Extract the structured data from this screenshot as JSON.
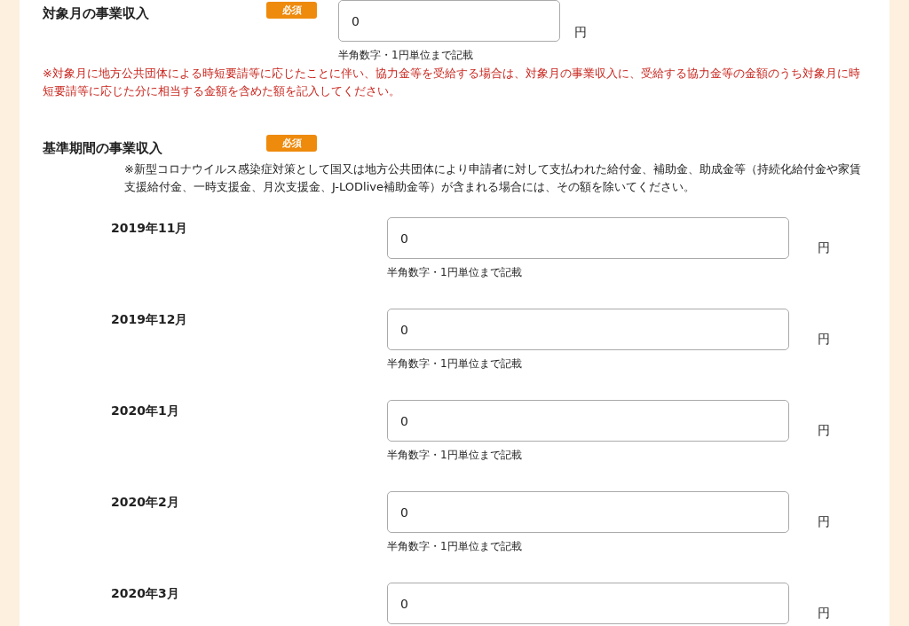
{
  "target_month": {
    "label": "対象月の事業収入",
    "badge": "必須",
    "value": "0",
    "unit": "円",
    "hint": "半角数字・1円単位まで記載",
    "note": "※対象月に地方公共団体による時短要請等に応じたことに伴い、協力金等を受給する場合は、対象月の事業収入に、受給する協力金等の金額のうち対象月に時短要請等に応じた分に相当する金額を含めた額を記入してください。"
  },
  "base_period": {
    "label": "基準期間の事業収入",
    "badge": "必須",
    "note": "※新型コロナウイルス感染症対策として国又は地方公共団体により申請者に対して支払われた給付金、補助金、助成金等（持続化給付金や家賃支援給付金、一時支援金、月次支援金、J-LODlive補助金等）が含まれる場合には、その額を除いてください。",
    "months": [
      {
        "label": "2019年11月",
        "value": "0",
        "unit": "円",
        "hint": "半角数字・1円単位まで記載"
      },
      {
        "label": "2019年12月",
        "value": "0",
        "unit": "円",
        "hint": "半角数字・1円単位まで記載"
      },
      {
        "label": "2020年1月",
        "value": "0",
        "unit": "円",
        "hint": "半角数字・1円単位まで記載"
      },
      {
        "label": "2020年2月",
        "value": "0",
        "unit": "円",
        "hint": "半角数字・1円単位まで記載"
      },
      {
        "label": "2020年3月",
        "value": "0",
        "unit": "円"
      }
    ]
  }
}
